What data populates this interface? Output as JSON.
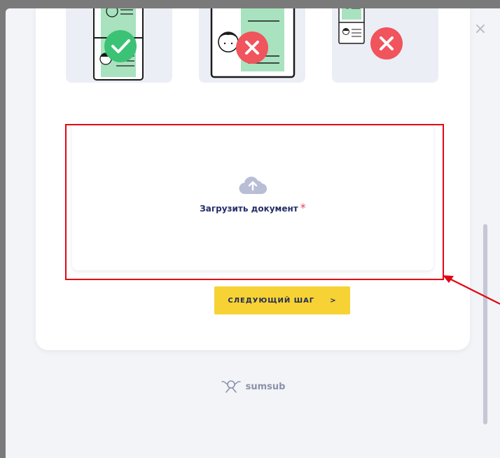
{
  "upload": {
    "label": "Загрузить документ",
    "required_mark": "*",
    "icon": "cloud-upload-icon"
  },
  "next_button": {
    "label": "СЛЕДУЮЩИЙ ШАГ",
    "arrow": ">"
  },
  "brand": {
    "name": "sumsub",
    "icon": "sumsub-logo-icon"
  },
  "close": {
    "glyph": "×",
    "icon": "close-icon"
  },
  "examples": [
    {
      "status": "valid",
      "icon": "check-icon",
      "color": "#3cc275"
    },
    {
      "status": "invalid",
      "icon": "cross-icon",
      "color": "#f0545c"
    },
    {
      "status": "invalid",
      "icon": "cross-icon",
      "color": "#f0545c"
    }
  ],
  "colors": {
    "accent": "#f6d235",
    "text_dark": "#252f6a",
    "required": "#e2445c",
    "highlight": "#e30613"
  }
}
